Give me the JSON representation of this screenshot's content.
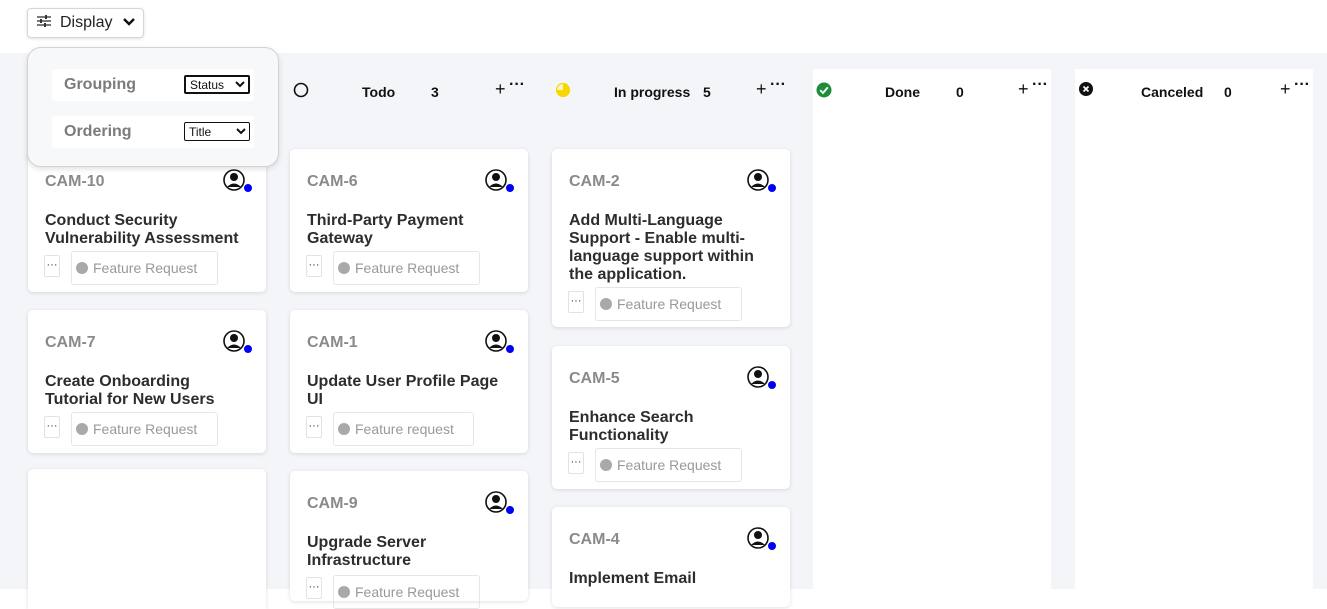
{
  "toolbar": {
    "display_label": "Display",
    "display_icon": "sliders-icon",
    "chevron_icon": "chevron-down-icon"
  },
  "display_popup": {
    "grouping_label": "Grouping",
    "grouping_value": "Status",
    "ordering_label": "Ordering",
    "ordering_value": "Title"
  },
  "columns": [
    {
      "title": "",
      "count": "",
      "cards": [
        {
          "id": "CAM-10",
          "title": "Conduct Security Vulnerability Assessment",
          "tag": "Feature Request",
          "menu": "···"
        },
        {
          "id": "CAM-7",
          "title": "Create Onboarding Tutorial for New Users",
          "tag": "Feature Request",
          "menu": "···"
        }
      ]
    },
    {
      "title": "Todo",
      "count": "3",
      "status_icon": "circle-outline-icon",
      "status_color": "#111111",
      "cards": [
        {
          "id": "CAM-6",
          "title": "Third-Party Payment Gateway",
          "tag": "Feature Request",
          "menu": "···"
        },
        {
          "id": "CAM-1",
          "title": "Update User Profile Page UI",
          "tag": "Feature request",
          "menu": "···"
        },
        {
          "id": "CAM-9",
          "title": "Upgrade Server Infrastructure",
          "tag": "Feature Request",
          "menu": "···"
        }
      ]
    },
    {
      "title": "In progress",
      "count": "5",
      "status_icon": "half-circle-icon",
      "status_color": "#f5d800",
      "cards": [
        {
          "id": "CAM-2",
          "title": "Add Multi-Language Support - Enable multi-language support within the application.",
          "tag": "Feature Request",
          "menu": "···"
        },
        {
          "id": "CAM-5",
          "title": "Enhance Search Functionality",
          "tag": "Feature Request",
          "menu": "···"
        },
        {
          "id": "CAM-4",
          "title": "Implement Email",
          "tag": "",
          "menu": ""
        }
      ]
    },
    {
      "title": "Done",
      "count": "0",
      "status_icon": "check-circle-icon",
      "status_color": "#1e8c3a",
      "cards": []
    },
    {
      "title": "Canceled",
      "count": "0",
      "status_icon": "x-circle-icon",
      "status_color": "#111111",
      "cards": []
    }
  ],
  "column_actions": {
    "add": "+",
    "more": "···"
  },
  "colors": {
    "board_bg": "#f4f5f8",
    "assignee_dot": "#0000f5",
    "tag_dot": "#a9a9a9"
  }
}
